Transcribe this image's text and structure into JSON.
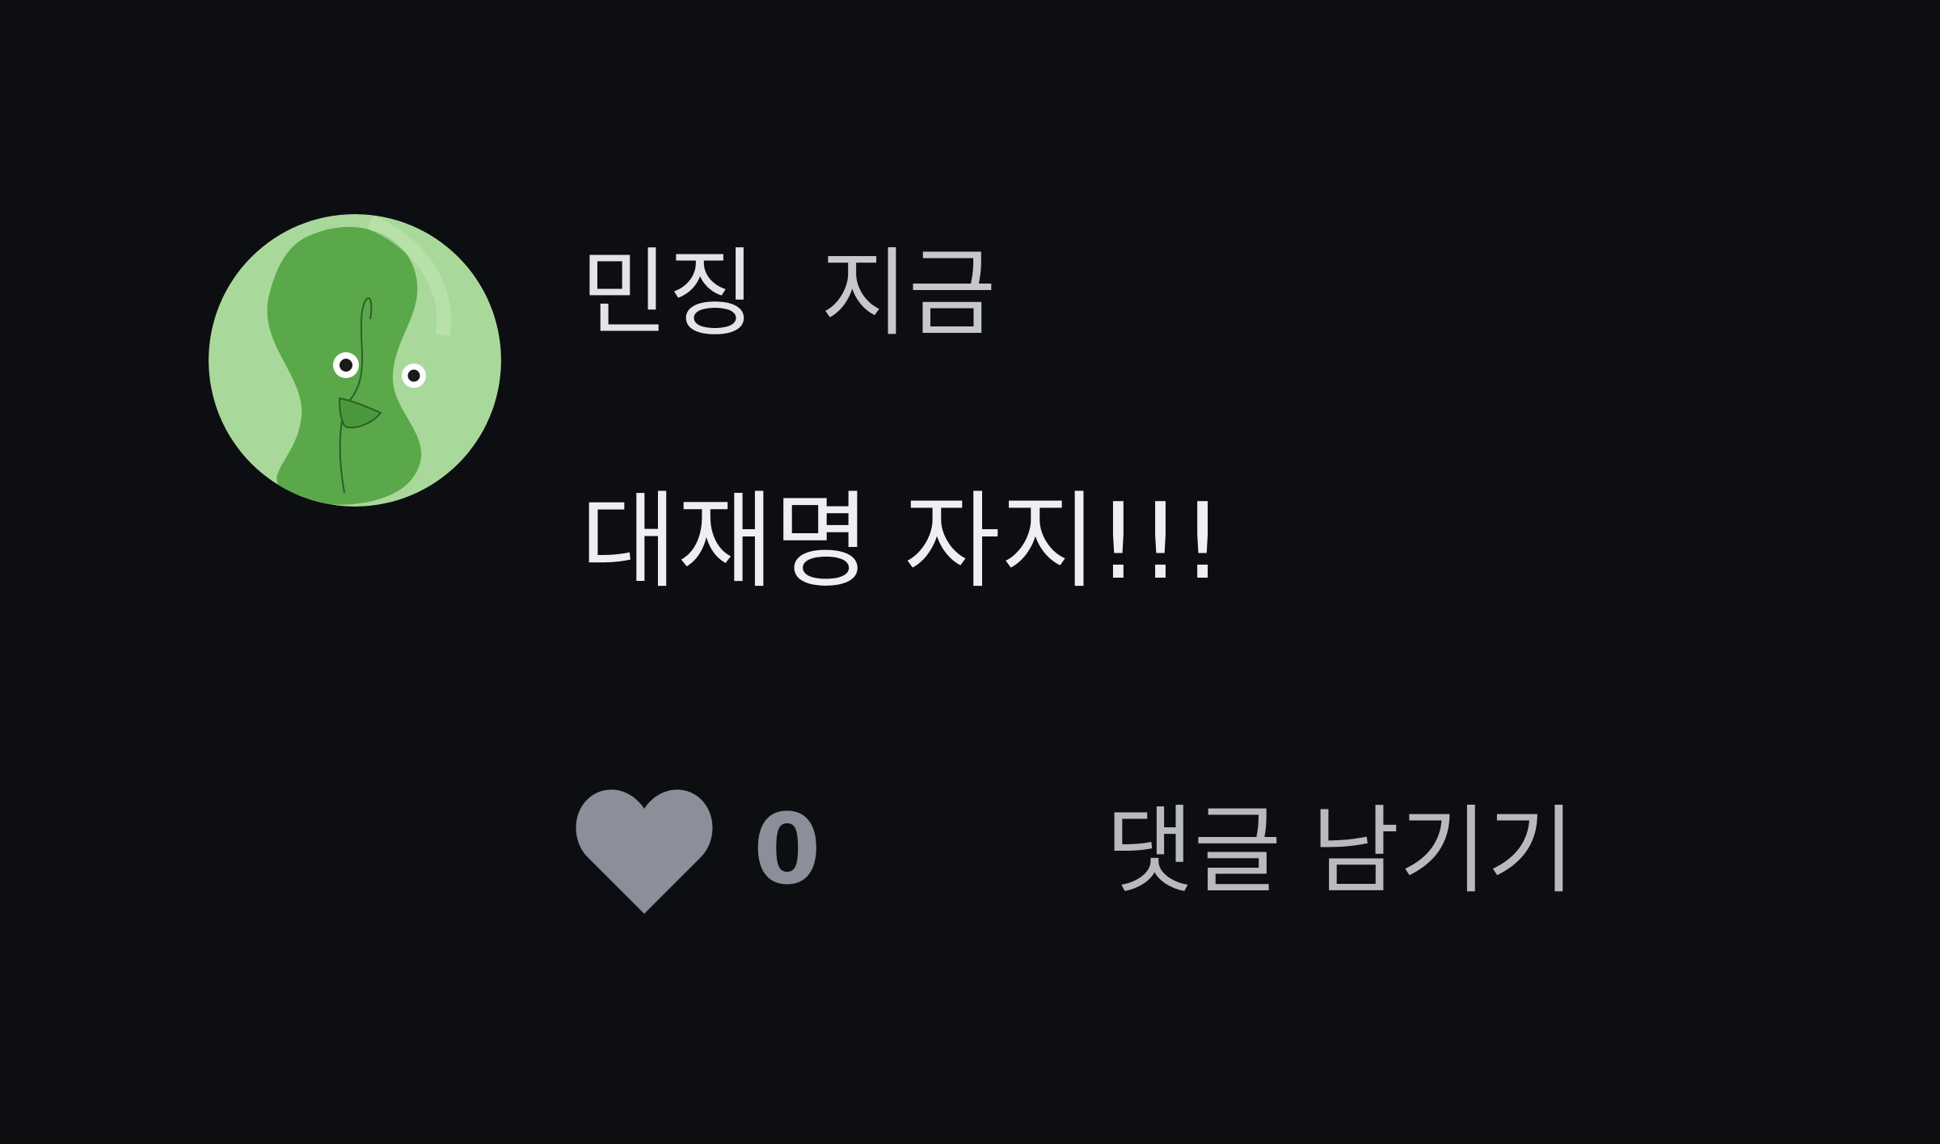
{
  "comment": {
    "author": "민징",
    "timestamp": "지금",
    "text": "대재명 자지!!!",
    "avatar_icon": "green-sprout-character-icon",
    "like": {
      "icon": "heart-icon",
      "count": "0"
    },
    "reply_label": "댓글 남기기"
  },
  "colors": {
    "background": "#0d0e12",
    "avatar_light": "#a9d99a",
    "avatar_dark": "#5aa84a",
    "heart": "#8b8f99",
    "author_text": "#e3e4e8",
    "body_text": "#eeeff2",
    "muted_text": "#b8bac0"
  }
}
